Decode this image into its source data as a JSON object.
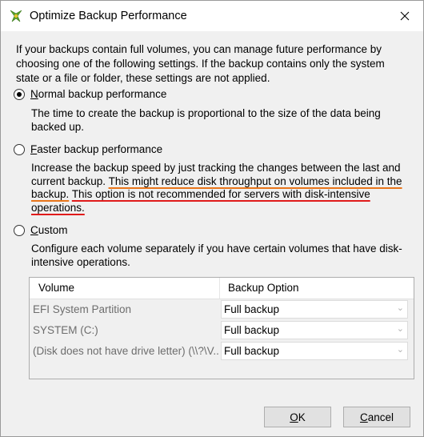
{
  "window": {
    "title": "Optimize Backup Performance"
  },
  "intro": "If your backups contain full volumes, you can manage future performance by choosing one of the following settings. If the backup contains only the system state or a file or folder, these settings are not applied.",
  "options": {
    "normal": {
      "label_key": "N",
      "label_rest": "ormal backup performance",
      "checked": true,
      "description": "The time to create the backup is proportional to the size of the data being backed up."
    },
    "faster": {
      "label_key": "F",
      "label_rest": "aster backup performance",
      "checked": false,
      "desc_plain": "Increase the backup speed by just tracking the changes between the last and current backup.",
      "desc_orange": "This might reduce disk throughput on volumes included in the backup.",
      "desc_red": "This option is not recommended for servers with disk-intensive operations."
    },
    "custom": {
      "label_key": "C",
      "label_rest": "ustom",
      "checked": false,
      "description": "Configure each volume separately if you have certain volumes that have disk-intensive operations."
    }
  },
  "table": {
    "headers": {
      "volume": "Volume",
      "option": "Backup Option"
    },
    "rows": [
      {
        "volume": "EFI System Partition",
        "option": "Full backup"
      },
      {
        "volume": "SYSTEM (C:)",
        "option": "Full backup"
      },
      {
        "volume": "(Disk does not have drive letter) (\\\\?\\V...",
        "option": "Full backup"
      }
    ]
  },
  "buttons": {
    "ok_key": "O",
    "ok_rest": "K",
    "cancel_key": "C",
    "cancel_rest": "ancel"
  },
  "colors": {
    "orange_underline": "#e8751a",
    "red_underline": "#e01b1b"
  }
}
